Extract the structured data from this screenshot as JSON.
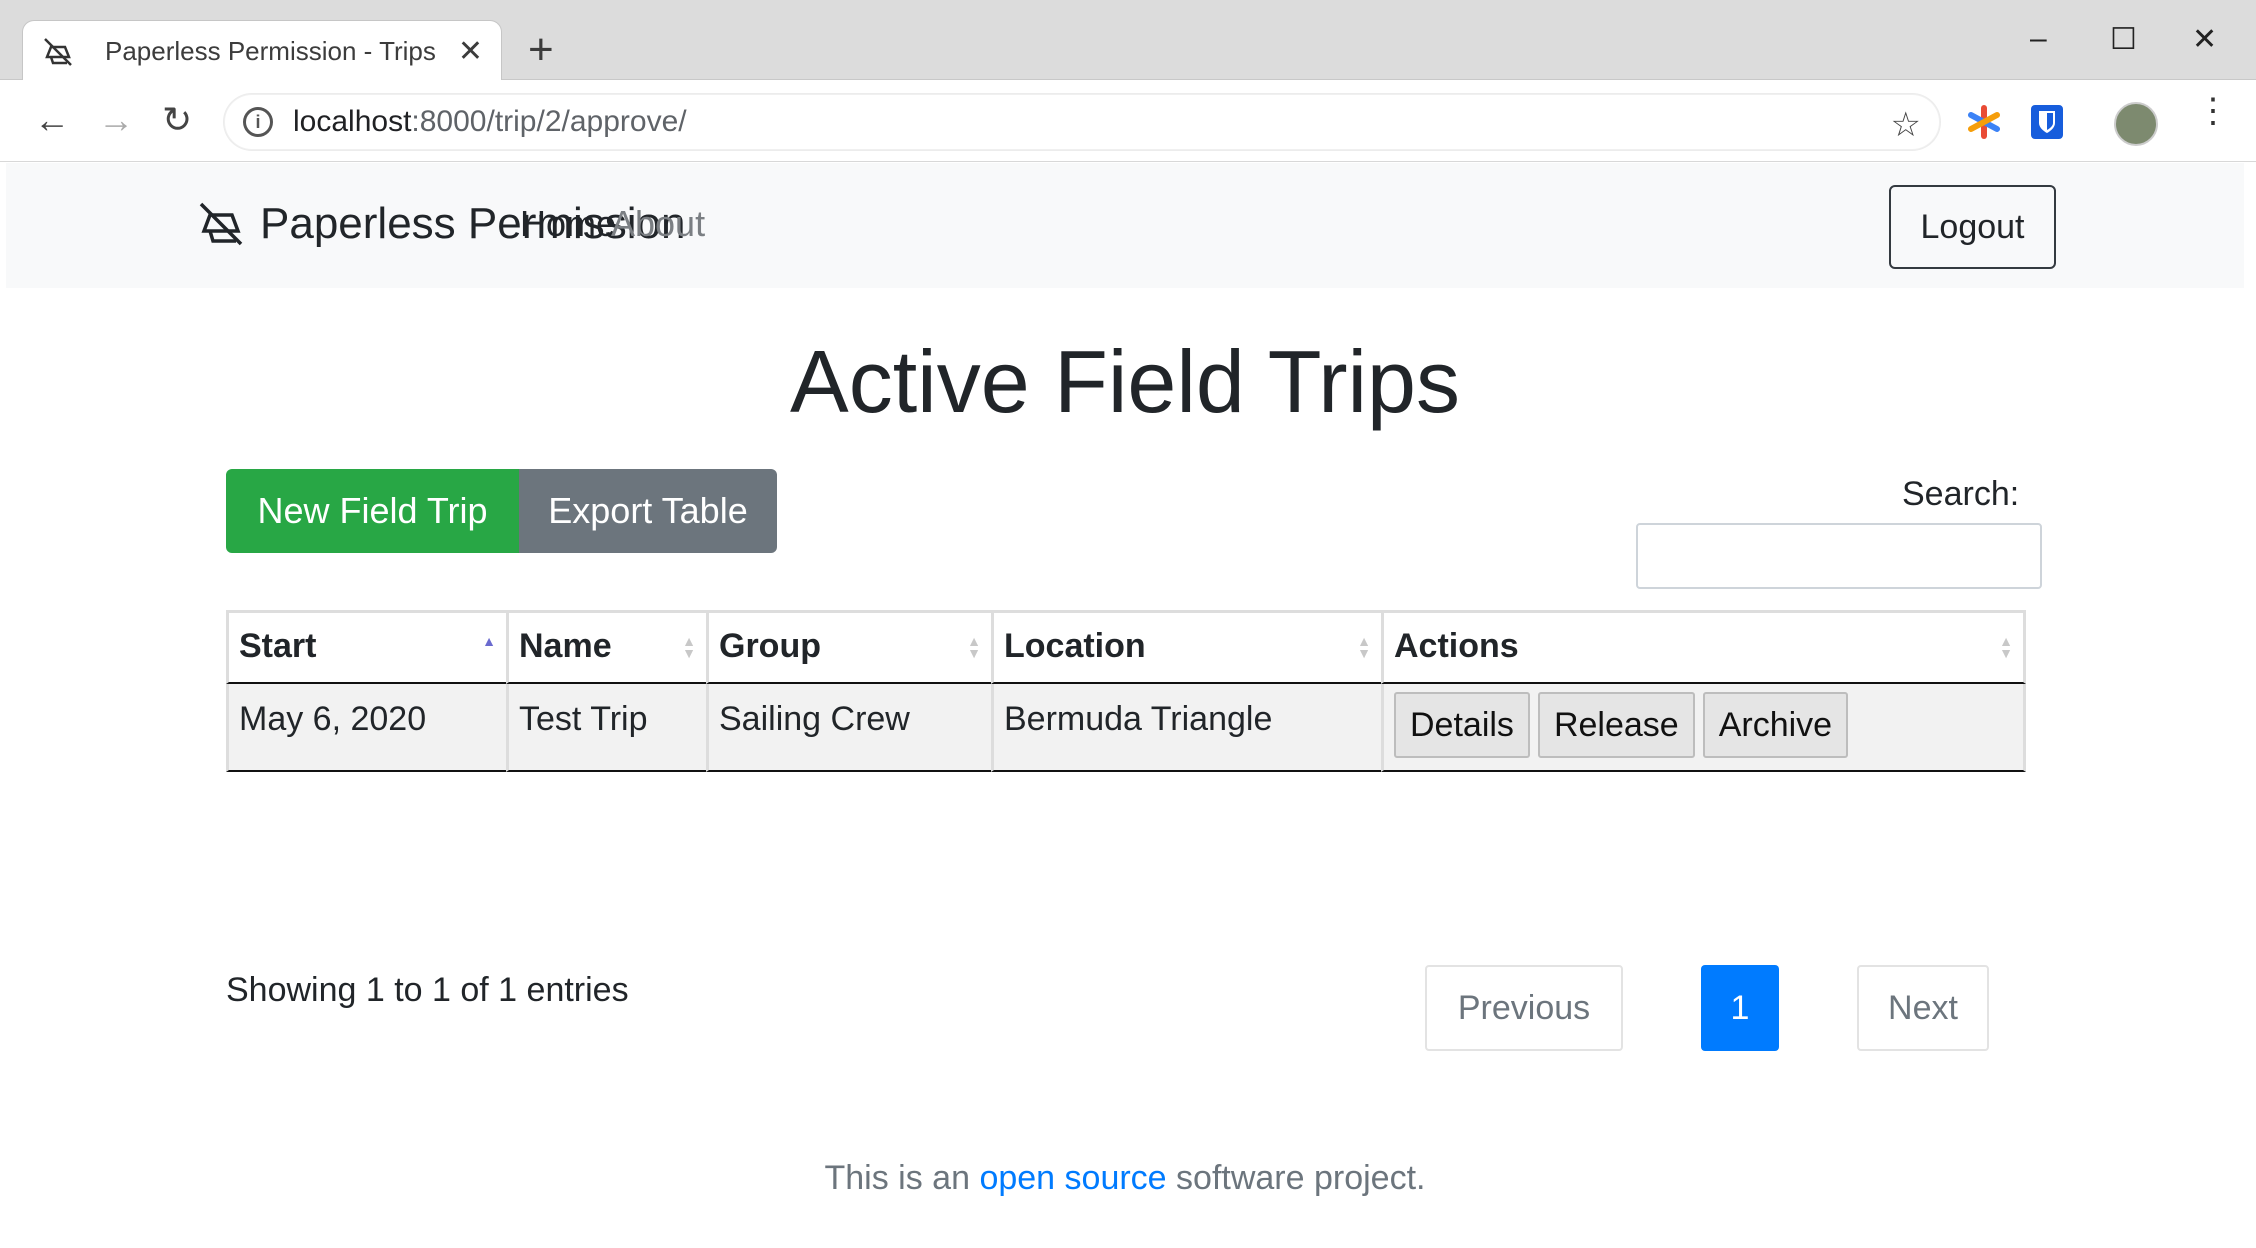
{
  "browser": {
    "tab_title": "Paperless Permission - Trips",
    "tab_close": "✕",
    "new_tab": "+",
    "url_host": "localhost",
    "url_path": ":8000/trip/2/approve/",
    "window_controls": [
      "–",
      "☐",
      "✕"
    ]
  },
  "navbar": {
    "brand": "Paperless Permission",
    "links": [
      {
        "label": "Home",
        "active": true
      },
      {
        "label": "About",
        "active": false
      }
    ],
    "logout_label": "Logout"
  },
  "main": {
    "title": "Active Field Trips",
    "new_button": "New Field Trip",
    "export_button": "Export Table",
    "search_label": "Search:",
    "search_value": ""
  },
  "table": {
    "columns": [
      {
        "label": "Start",
        "sort": "asc"
      },
      {
        "label": "Name",
        "sort": "none"
      },
      {
        "label": "Group",
        "sort": "none"
      },
      {
        "label": "Location",
        "sort": "none"
      },
      {
        "label": "Actions",
        "sort": "none"
      }
    ],
    "rows": [
      {
        "start": "May 6, 2020",
        "name": "Test Trip",
        "group": "Sailing Crew",
        "location": "Bermuda Triangle",
        "actions": [
          "Details",
          "Release",
          "Archive"
        ]
      }
    ]
  },
  "pagination": {
    "info": "Showing 1 to 1 of 1 entries",
    "previous": "Previous",
    "current_page": "1",
    "next": "Next"
  },
  "footer": {
    "prefix": "This is an ",
    "link_text": "open source",
    "suffix": " software project."
  },
  "colors": {
    "success": "#28a745",
    "secondary": "#6c757d",
    "primary": "#007bff",
    "navbar_bg": "#f8f9fa"
  }
}
